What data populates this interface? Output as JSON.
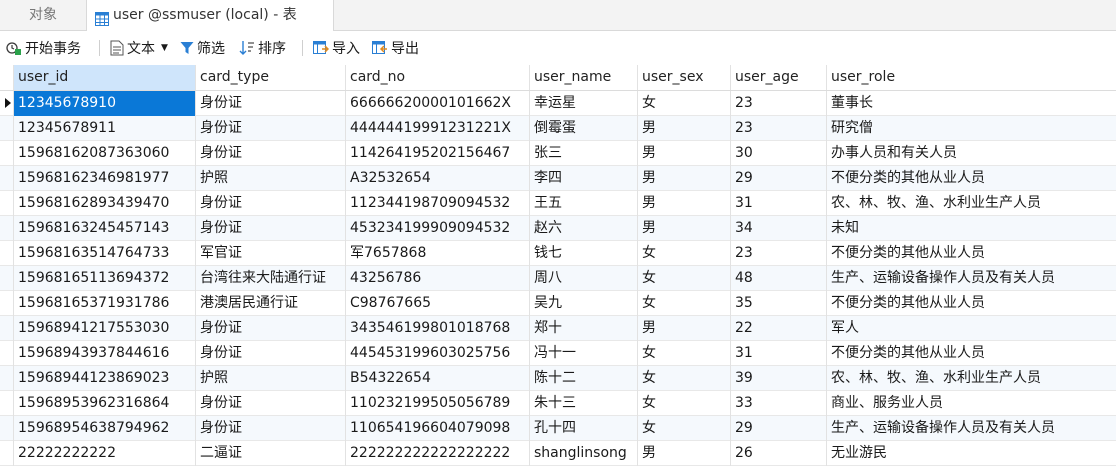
{
  "tabs": {
    "objects_label": "对象",
    "active_label": "user @ssmuser (local) - 表"
  },
  "toolbar": {
    "begin_transaction": "开始事务",
    "text": "文本",
    "filter": "筛选",
    "sort": "排序",
    "import": "导入",
    "export": "导出"
  },
  "table": {
    "columns": [
      "user_id",
      "card_type",
      "card_no",
      "user_name",
      "user_sex",
      "user_age",
      "user_role"
    ],
    "rows": [
      [
        "12345678910",
        "身份证",
        "66666620000101662X",
        "幸运星",
        "女",
        "23",
        "董事长"
      ],
      [
        "12345678911",
        "身份证",
        "44444419991231221X",
        "倒霉蛋",
        "男",
        "23",
        "研究僧"
      ],
      [
        "15968162087363060",
        "身份证",
        "11426419520215646​7",
        "张三",
        "男",
        "30",
        "办事人员和有关人员"
      ],
      [
        "15968162346981977",
        "护照",
        "A32532654",
        "李四",
        "男",
        "29",
        "不便分类的其他从业人员"
      ],
      [
        "15968162893439470",
        "身份证",
        "112344198709094532",
        "王五",
        "男",
        "31",
        "农、林、牧、渔、水利业生产人员"
      ],
      [
        "15968163245457143",
        "身份证",
        "453234199909094532",
        "赵六",
        "男",
        "34",
        "未知"
      ],
      [
        "15968163514764733",
        "军官证",
        "军7657868",
        "钱七",
        "女",
        "23",
        "不便分类的其他从业人员"
      ],
      [
        "15968165113694372",
        "台湾往来大陆通行证",
        "43256786",
        "周八",
        "女",
        "48",
        "生产、运输设备操作人员及有关人员"
      ],
      [
        "15968165371931786",
        "港澳居民通行证",
        "C98767665",
        "吴九",
        "女",
        "35",
        "不便分类的其他从业人员"
      ],
      [
        "15968941217553030",
        "身份证",
        "343546199801018768",
        "郑十",
        "男",
        "22",
        "军人"
      ],
      [
        "15968943937844616",
        "身份证",
        "445453199603025756",
        "冯十一",
        "女",
        "31",
        "不便分类的其他从业人员"
      ],
      [
        "15968944123869023",
        "护照",
        "B54322654",
        "陈十二",
        "女",
        "39",
        "农、林、牧、渔、水利业生产人员"
      ],
      [
        "15968953962316864",
        "身份证",
        "110232199505056789",
        "朱十三",
        "女",
        "33",
        "商业、服务业人员"
      ],
      [
        "15968954638794962",
        "身份证",
        "110654196604079098",
        "孔十四",
        "女",
        "29",
        "生产、运输设备操作人员及有关人员"
      ],
      [
        "22222222222",
        "二逼证",
        "222222222222222222",
        "shanglinsong",
        "男",
        "26",
        "无业游民"
      ]
    ]
  },
  "colors": {
    "selection": "#0a78d7",
    "header_selected": "#cfe5fb",
    "toolbar_icon_blue": "#2a7fd4"
  }
}
